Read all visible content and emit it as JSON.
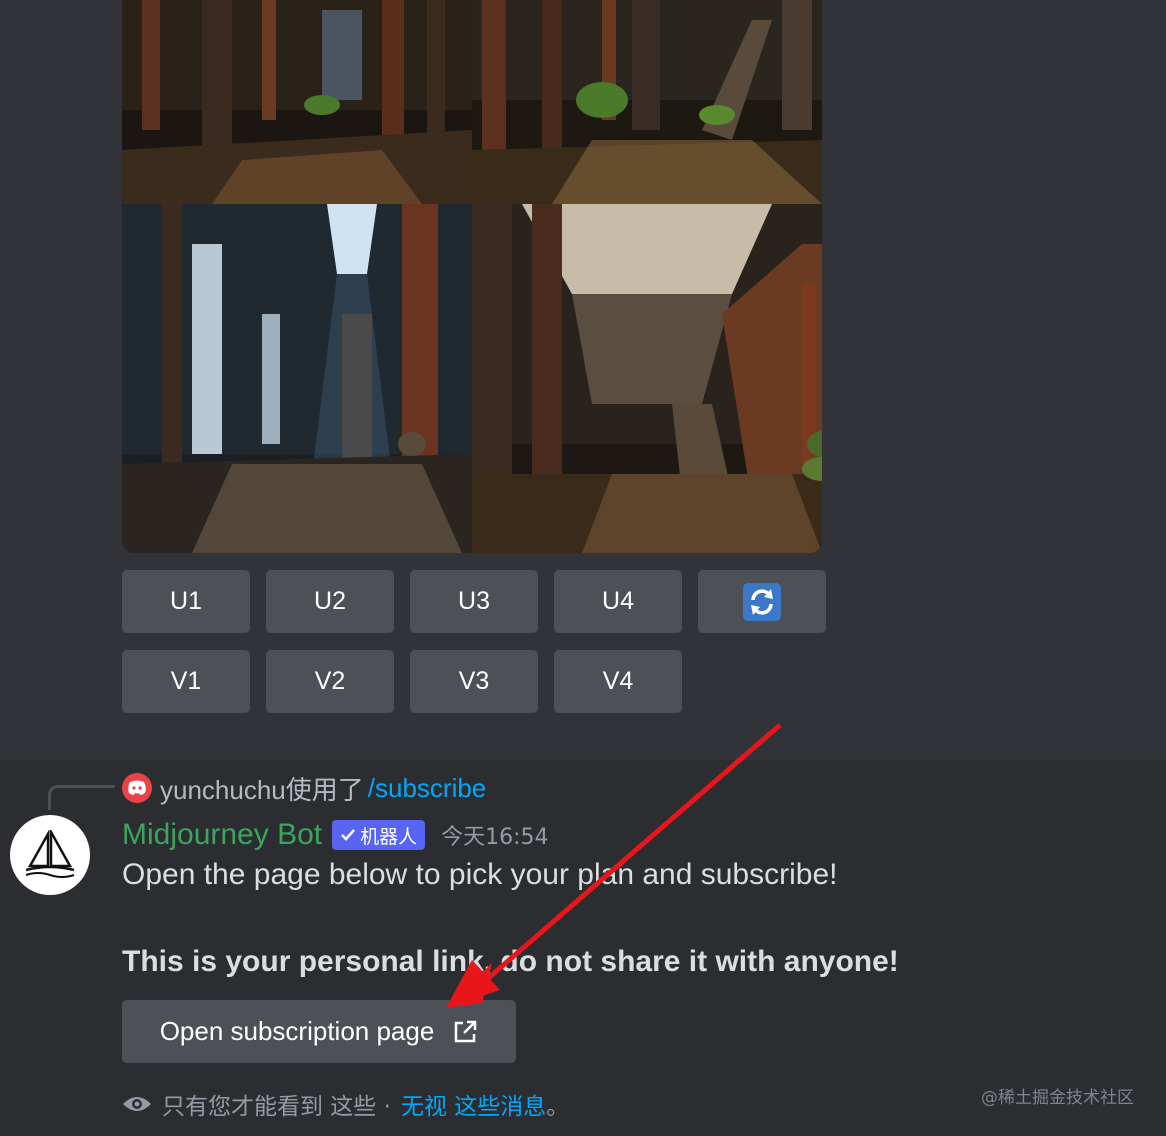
{
  "image_grid": {
    "alt_tiles": [
      "tile-1",
      "tile-2",
      "tile-3",
      "tile-4"
    ]
  },
  "upscale_buttons": [
    "U1",
    "U2",
    "U3",
    "U4"
  ],
  "variation_buttons": [
    "V1",
    "V2",
    "V3",
    "V4"
  ],
  "reroll_icon": "reroll-icon",
  "reply": {
    "user": "yunchuchu使用了",
    "command": "/subscribe"
  },
  "message": {
    "bot_name": "Midjourney Bot",
    "bot_tag": "机器人",
    "timestamp": "今天16:54",
    "line1": "Open the page below to pick your plan and subscribe!",
    "line2": "This is your personal link, do not share it with anyone!",
    "open_button": "Open subscription page"
  },
  "ephemeral": {
    "text": "只有您才能看到 这些 ·",
    "dismiss": "无视 这些消息",
    "end": "。"
  },
  "watermark": "@稀土掘金技术社区",
  "colors": {
    "background": "#313338",
    "message_bg": "#2b2d31",
    "button": "#4e5058",
    "bot_name": "#3ba55d",
    "bot_tag": "#5865f2",
    "link": "#00a8fc",
    "reroll_blue": "#3c78c8",
    "annotation_arrow": "#e8161b"
  }
}
